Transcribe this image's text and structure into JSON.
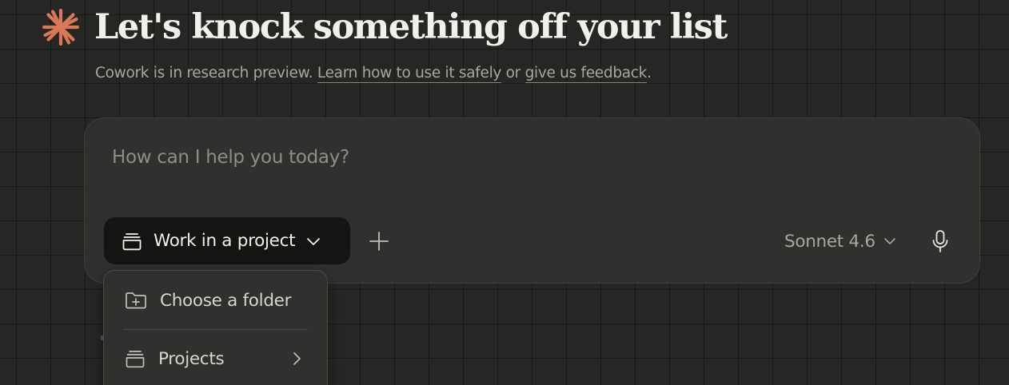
{
  "header": {
    "logo_icon": "asterisk-sparkle-icon",
    "logo_color": "#d97757",
    "title": "Let's knock something off your list"
  },
  "subtitle": {
    "prefix": "Cowork is in research preview. ",
    "link1": "Learn how to use it safely",
    "middle": " or ",
    "link2": "give us feedback",
    "suffix": "."
  },
  "composer": {
    "placeholder": "How can I help you today?",
    "project_button": {
      "icon": "stack-box-icon",
      "label": "Work in a project",
      "chevron_icon": "chevron-down-icon"
    },
    "add_icon": "plus-icon",
    "model": {
      "label": "Sonnet 4.6",
      "chevron_icon": "chevron-down-icon"
    },
    "mic_icon": "microphone-icon"
  },
  "dropdown": {
    "items": [
      {
        "label": "Choose a folder",
        "icon": "folder-plus-icon"
      },
      {
        "label": "Projects",
        "icon": "stack-box-icon",
        "arrow_icon": "chevron-right-icon"
      }
    ]
  }
}
